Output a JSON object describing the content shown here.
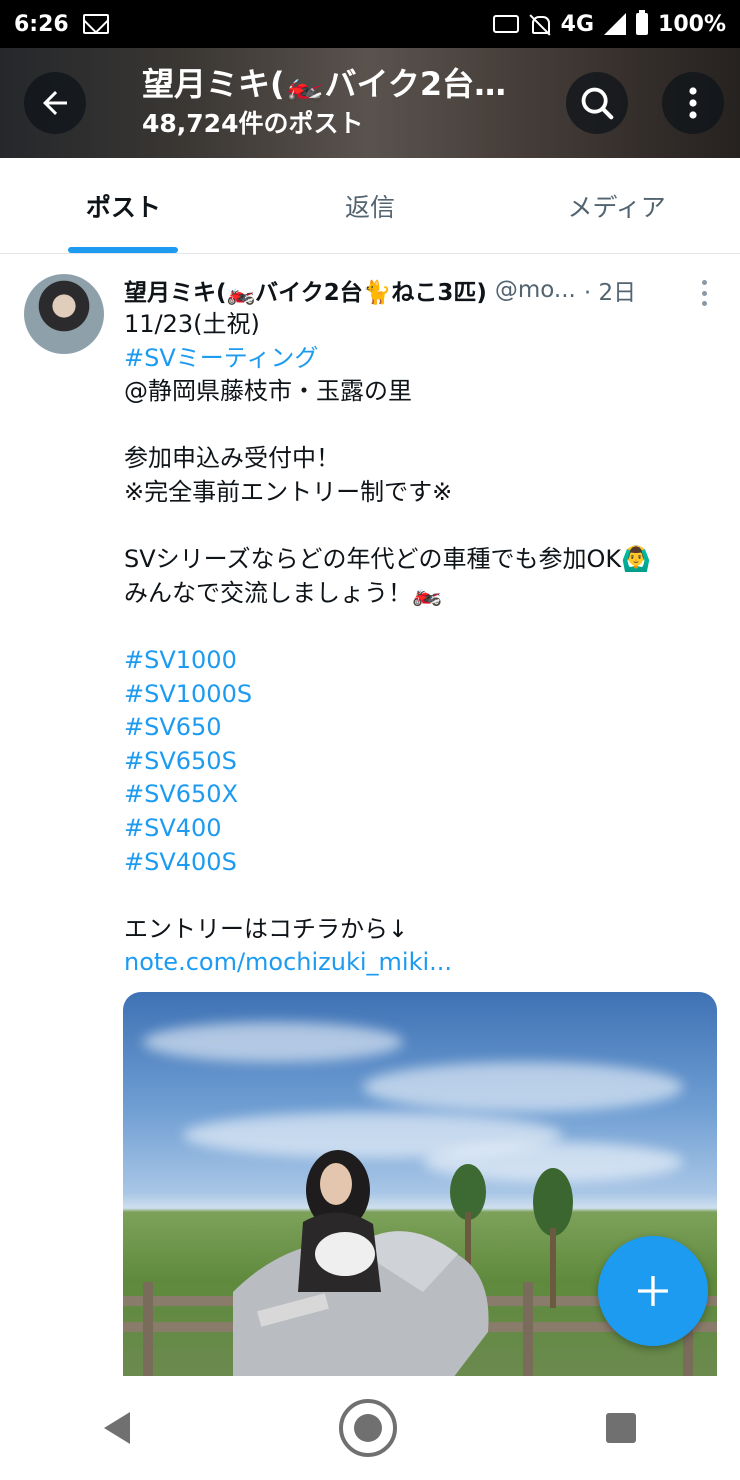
{
  "status_bar": {
    "time": "6:26",
    "network": "4G",
    "battery": "100%"
  },
  "header": {
    "title": "望月ミキ(🏍️バイク2台…",
    "post_count": "48,724件のポスト"
  },
  "tabs": [
    {
      "label": "ポスト",
      "active": true
    },
    {
      "label": "返信",
      "active": false
    },
    {
      "label": "メディア",
      "active": false
    }
  ],
  "tweet": {
    "name": "望月ミキ(🏍️バイク2台🐈ねこ3匹)",
    "handle": "@mo...",
    "time": "· 2日",
    "lines": [
      {
        "text": "11/23(土祝)",
        "link": false
      },
      {
        "text": "#SVミーティング",
        "link": true
      },
      {
        "text": "@静岡県藤枝市・玉露の里",
        "link": false
      },
      {
        "text": "",
        "link": false
      },
      {
        "text": "参加申込み受付中！",
        "link": false
      },
      {
        "text": "※完全事前エントリー制です※",
        "link": false
      },
      {
        "text": "",
        "link": false
      },
      {
        "text": "SVシリーズならどの年代どの車種でも参加OK🙆‍♂️",
        "link": false
      },
      {
        "text": "みんなで交流しましょう！🏍️",
        "link": false
      },
      {
        "text": "",
        "link": false
      },
      {
        "text": "#SV1000",
        "link": true
      },
      {
        "text": "#SV1000S",
        "link": true
      },
      {
        "text": "#SV650",
        "link": true
      },
      {
        "text": "#SV650S",
        "link": true
      },
      {
        "text": "#SV650X",
        "link": true
      },
      {
        "text": "#SV400",
        "link": true
      },
      {
        "text": "#SV400S",
        "link": true
      },
      {
        "text": "",
        "link": false
      },
      {
        "text": "エントリーはコチラから↓",
        "link": false
      },
      {
        "text": "note.com/mochizuki_miki...",
        "link": true
      }
    ]
  },
  "icons": {
    "back": "arrow-left-icon",
    "search": "search-icon",
    "more": "more-vertical-icon",
    "compose": "plus-icon"
  },
  "colors": {
    "accent": "#1d9bf0",
    "text": "#0f1419",
    "muted": "#536471"
  }
}
